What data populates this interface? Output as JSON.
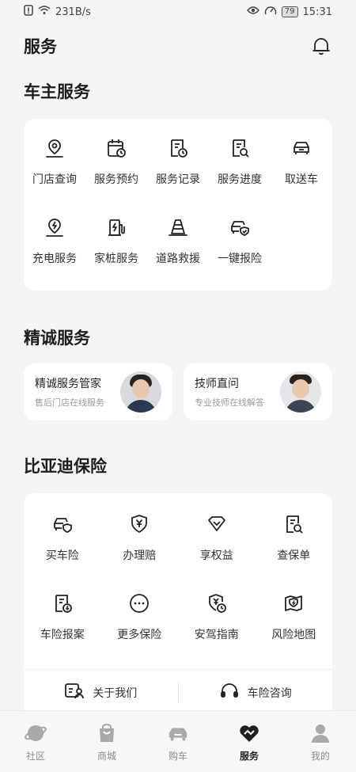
{
  "status_bar": {
    "speed": "231B/s",
    "battery": "79",
    "time": "15:31"
  },
  "header": {
    "title": "服务"
  },
  "owner_services": {
    "title": "车主服务",
    "items": [
      {
        "label": "门店查询",
        "icon": "store-location-icon"
      },
      {
        "label": "服务预约",
        "icon": "calendar-clock-icon"
      },
      {
        "label": "服务记录",
        "icon": "document-clock-icon"
      },
      {
        "label": "服务进度",
        "icon": "document-search-icon"
      },
      {
        "label": "取送车",
        "icon": "car-icon"
      },
      {
        "label": "充电服务",
        "icon": "charge-location-icon"
      },
      {
        "label": "家桩服务",
        "icon": "charging-pile-icon"
      },
      {
        "label": "道路救援",
        "icon": "traffic-cone-icon"
      },
      {
        "label": "一键报险",
        "icon": "car-shield-icon"
      }
    ]
  },
  "premium_services": {
    "title": "精诚服务",
    "cards": [
      {
        "title": "精诚服务管家",
        "subtitle": "售后门店在线服务"
      },
      {
        "title": "技师直问",
        "subtitle": "专业技师在线解答"
      }
    ]
  },
  "insurance": {
    "title": "比亚迪保险",
    "items": [
      {
        "label": "买车险",
        "icon": "car-shield-icon"
      },
      {
        "label": "办理赔",
        "icon": "yen-shield-icon"
      },
      {
        "label": "享权益",
        "icon": "gem-icon"
      },
      {
        "label": "查保单",
        "icon": "document-search-icon"
      },
      {
        "label": "车险报案",
        "icon": "document-alert-icon"
      },
      {
        "label": "更多保险",
        "icon": "more-circle-icon"
      },
      {
        "label": "安驾指南",
        "icon": "shield-clock-icon"
      },
      {
        "label": "风险地图",
        "icon": "risk-map-icon"
      }
    ],
    "links": [
      {
        "label": "关于我们",
        "icon": "about-us-icon"
      },
      {
        "label": "车险咨询",
        "icon": "headset-icon"
      }
    ]
  },
  "tabbar": {
    "items": [
      {
        "label": "社区",
        "icon": "planet-icon"
      },
      {
        "label": "商城",
        "icon": "shopping-bag-icon"
      },
      {
        "label": "购车",
        "icon": "car-icon"
      },
      {
        "label": "服务",
        "icon": "service-heart-icon"
      },
      {
        "label": "我的",
        "icon": "user-icon"
      }
    ],
    "active_index": 3
  }
}
